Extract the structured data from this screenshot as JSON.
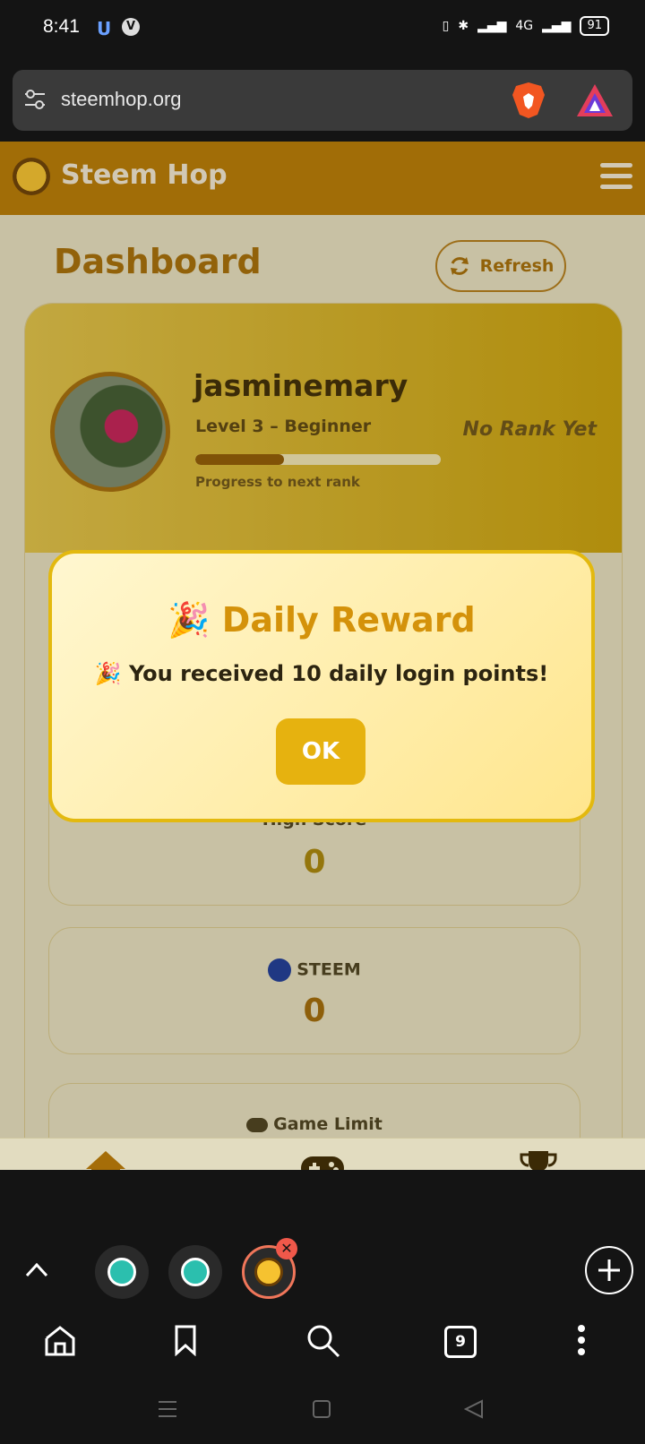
{
  "status_bar": {
    "time": "8:41",
    "battery": "91",
    "network": "4G"
  },
  "browser": {
    "url": "steemhop.org",
    "tab_count": "9"
  },
  "site": {
    "name": "Steem Hop",
    "logo_text": "STEEM HOP"
  },
  "dashboard": {
    "title": "Dashboard",
    "refresh_label": "Refresh"
  },
  "profile": {
    "username": "jasminemary",
    "level": "Level 3 – Beginner",
    "rank": "No Rank Yet",
    "progress_label": "Progress to next rank",
    "progress_fraction": 0.36
  },
  "stats": [
    {
      "label": "High Score",
      "value": "0"
    },
    {
      "label": "STEEM",
      "value": "0"
    },
    {
      "label": "Game Limit",
      "value": ""
    }
  ],
  "modal": {
    "title": "🎉 Daily Reward",
    "message": "🎉 You received 10 daily login points!",
    "ok_label": "OK"
  },
  "colors": {
    "header": "#b77a04",
    "accent": "#e6b20f",
    "title": "#a56d08"
  }
}
